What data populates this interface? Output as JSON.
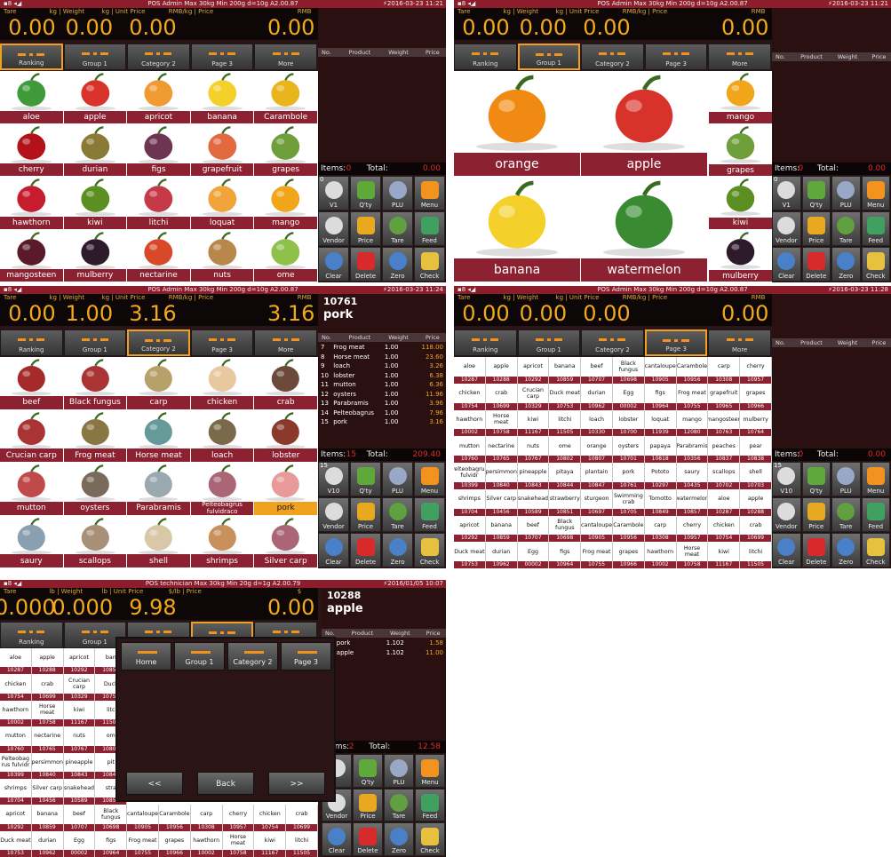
{
  "colors": {
    "accent": "#f2a91a",
    "bar": "#8c2231",
    "dark": "#2a1416",
    "total": "#e32b2b"
  },
  "screens": [
    {
      "status_center": "POS  Admin  Max 30kg Min 200g d=10g  A2.00.87",
      "status_time": "2016-03-23 11:21",
      "hdr": {
        "labels": [
          "Tare",
          "kg | Weight",
          "kg | Unit Price",
          "RMB/kg | Price",
          "RMB"
        ],
        "values": [
          "0.00",
          "0.00",
          "0.00",
          "0.00"
        ]
      },
      "tabs": [
        "Ranking",
        "Group 1",
        "Category 2",
        "Page 3",
        "More"
      ],
      "sel_tab": 0,
      "items": [
        "aloe",
        "apple",
        "apricot",
        "banana",
        "Carambole",
        "cherry",
        "durian",
        "figs",
        "grapefruit",
        "grapes",
        "hawthorn",
        "kiwi",
        "litchi",
        "loquat",
        "mango",
        "mangosteen",
        "mulberry",
        "nectarine",
        "nuts",
        "ome"
      ],
      "cols": [
        "No.",
        "Product",
        "Weight",
        "Price"
      ],
      "rows": [],
      "items_label": "Items:",
      "items_count": "0",
      "total_label": "Total:",
      "total": "0.00",
      "btns": [
        "V1",
        "Q'ty",
        "PLU",
        "Menu",
        "Vendor",
        "Price",
        "Tare",
        "Feed",
        "Clear",
        "Delete",
        "Zero",
        "Check"
      ],
      "v_badge": "0"
    },
    {
      "status_center": "POS  Admin  Max 30kg Min 200g d=10g  A2.00.87",
      "status_time": "2016-03-23 11:21",
      "hdr": {
        "labels": [
          "Tare",
          "kg | Weight",
          "kg | Unit Price",
          "RMB/kg | Price",
          "RMB"
        ],
        "values": [
          "0.00",
          "0.00",
          "0.00",
          "0.00"
        ]
      },
      "tabs": [
        "Ranking",
        "Group 1",
        "Category 2",
        "Page 3",
        "More"
      ],
      "sel_tab": 1,
      "big_items": [
        "orange",
        "apple",
        "banana",
        "watermelon"
      ],
      "side_items": [
        "mango",
        "grapes",
        "kiwi",
        "mulberry"
      ],
      "cols": [
        "No.",
        "Product",
        "Weight",
        "Price"
      ],
      "items_label": "Items:",
      "items_count": "0",
      "total_label": "Total:",
      "total": "0.00",
      "btns": [
        "V1",
        "Q'ty",
        "PLU",
        "Menu",
        "Vendor",
        "Price",
        "Tare",
        "Feed",
        "Clear",
        "Delete",
        "Zero",
        "Check"
      ],
      "v_badge": "0"
    },
    {
      "status_center": "POS  Admin  Max 30kg Min 200g d=10g  A2.00.87",
      "status_time": "2016-03-23 11:24",
      "hdr": {
        "labels": [
          "Tare",
          "kg | Weight",
          "kg | Unit Price",
          "RMB/kg | Price",
          "RMB"
        ],
        "values": [
          "0.00",
          "1.00",
          "3.16",
          "3.16"
        ]
      },
      "plu": "10761",
      "product": "pork",
      "tabs": [
        "Ranking",
        "Group 1",
        "Category 2",
        "Page 3",
        "More"
      ],
      "sel_tab": 2,
      "items": [
        "beef",
        "Black fungus",
        "carp",
        "chicken",
        "crab",
        "Crucian carp",
        "Frog meat",
        "Horse meat",
        "loach",
        "lobster",
        "mutton",
        "oysters",
        "Parabramis",
        "Pelteobagrus fulvidraco",
        "pork",
        "saury",
        "scallops",
        "shell",
        "shrimps",
        "Silver carp"
      ],
      "hi_item": 14,
      "cols": [
        "No.",
        "Product",
        "Weight",
        "Price"
      ],
      "rows": [
        [
          "7",
          "Frog meat",
          "1.00",
          "118.00"
        ],
        [
          "8",
          "Horse meat",
          "1.00",
          "23.60"
        ],
        [
          "9",
          "loach",
          "1.00",
          "3.26"
        ],
        [
          "10",
          "lobster",
          "1.00",
          "6.38"
        ],
        [
          "11",
          "mutton",
          "1.00",
          "6.36"
        ],
        [
          "12",
          "oysters",
          "1.00",
          "11.96"
        ],
        [
          "13",
          "Parabramis",
          "1.00",
          "3.96"
        ],
        [
          "14",
          "Pelteobagrus",
          "1.00",
          "7.96"
        ],
        [
          "15",
          "pork",
          "1.00",
          "3.16"
        ]
      ],
      "items_label": "Items:",
      "items_count": "15",
      "total_label": "Total:",
      "total": "209.40",
      "btns": [
        "V10",
        "Q'ty",
        "PLU",
        "Menu",
        "Vendor",
        "Price",
        "Tare",
        "Feed",
        "Clear",
        "Delete",
        "Zero",
        "Check"
      ],
      "v_badge": "15"
    },
    {
      "status_center": "POS  Admin  Max 30kg Min 200g d=10g  A2.00.87",
      "status_time": "2016-03-23 11:28",
      "hdr": {
        "labels": [
          "Tare",
          "kg | Weight",
          "kg | Unit Price",
          "RMB/kg | Price",
          "RMB"
        ],
        "values": [
          "0.00",
          "0.00",
          "0.00",
          "0.00"
        ]
      },
      "tabs": [
        "Ranking",
        "Group 1",
        "Category 2",
        "Page 3",
        "More"
      ],
      "sel_tab": 3,
      "tcells": [
        [
          "aloe",
          "10287"
        ],
        [
          "apple",
          "10288"
        ],
        [
          "apricot",
          "10292"
        ],
        [
          "banana",
          "10859"
        ],
        [
          "beef",
          "10707"
        ],
        [
          "Black fungus",
          "10698"
        ],
        [
          "cantaloupe",
          "10905"
        ],
        [
          "Carambole",
          "10956"
        ],
        [
          "carp",
          "10308"
        ],
        [
          "cherry",
          "10957"
        ],
        [
          "chicken",
          "10754"
        ],
        [
          "crab",
          "10699"
        ],
        [
          "Crucian carp",
          "10329"
        ],
        [
          "Duck meat",
          "10753"
        ],
        [
          "durian",
          "10962"
        ],
        [
          "Egg",
          "00002"
        ],
        [
          "figs",
          "10964"
        ],
        [
          "Frog meat",
          "10755"
        ],
        [
          "grapefruit",
          "10965"
        ],
        [
          "grapes",
          "10966"
        ],
        [
          "hawthorn",
          "10002"
        ],
        [
          "Horse meat",
          "10758"
        ],
        [
          "kiwi",
          "11167"
        ],
        [
          "litchi",
          "11505"
        ],
        [
          "loach",
          "10330"
        ],
        [
          "lobster",
          "10700"
        ],
        [
          "loquat",
          "11939"
        ],
        [
          "mango",
          "12080"
        ],
        [
          "mangosteen",
          "10763"
        ],
        [
          "mulberry",
          "10764"
        ],
        [
          "mutton",
          "10760"
        ],
        [
          "nectarine",
          "10765"
        ],
        [
          "nuts",
          "10767"
        ],
        [
          "ome",
          "10802"
        ],
        [
          "orange",
          "10807"
        ],
        [
          "oysters",
          "10701"
        ],
        [
          "papaya",
          "10818"
        ],
        [
          "Parabramis",
          "10356"
        ],
        [
          "peaches",
          "10837"
        ],
        [
          "pear",
          "10838"
        ],
        [
          "Pelteobagrus fulvidr",
          "10399"
        ],
        [
          "persimmon",
          "10840"
        ],
        [
          "pineapple",
          "10843"
        ],
        [
          "pitaya",
          "10844"
        ],
        [
          "plantain",
          "10847"
        ],
        [
          "pork",
          "10761"
        ],
        [
          "Pototo",
          "10297"
        ],
        [
          "saury",
          "10435"
        ],
        [
          "scallops",
          "10702"
        ],
        [
          "shell",
          "10703"
        ],
        [
          "shrimps",
          "10704"
        ],
        [
          "Silver carp",
          "10456"
        ],
        [
          "snakehead",
          "10589"
        ],
        [
          "strawberry",
          "10851"
        ],
        [
          "sturgeon",
          "10697"
        ],
        [
          "Swimming crab",
          "10705"
        ],
        [
          "Tomotto",
          "10849"
        ],
        [
          "watermelon",
          "10857"
        ],
        [
          "aloe",
          "10287"
        ],
        [
          "apple",
          "10288"
        ],
        [
          "apricot",
          "10292"
        ],
        [
          "banana",
          "10859"
        ],
        [
          "beef",
          "10707"
        ],
        [
          "Black fungus",
          "10698"
        ],
        [
          "cantaloupe",
          "10905"
        ],
        [
          "Carambole",
          "10956"
        ],
        [
          "carp",
          "10308"
        ],
        [
          "cherry",
          "10957"
        ],
        [
          "chicken",
          "10754"
        ],
        [
          "crab",
          "10699"
        ],
        [
          "Duck meat",
          "10753"
        ],
        [
          "durian",
          "10962"
        ],
        [
          "Egg",
          "00002"
        ],
        [
          "figs",
          "10964"
        ],
        [
          "Frog meat",
          "10755"
        ],
        [
          "grapes",
          "10966"
        ],
        [
          "hawthorn",
          "10002"
        ],
        [
          "Horse meat",
          "10758"
        ],
        [
          "kiwi",
          "11167"
        ],
        [
          "litchi",
          "11505"
        ]
      ],
      "cols": [
        "No.",
        "Product",
        "Weight",
        "Price"
      ],
      "items_label": "Items:",
      "items_count": "0",
      "total_label": "Total:",
      "total": "0.00",
      "btns": [
        "V10",
        "Q'ty",
        "PLU",
        "Menu",
        "Vendor",
        "Price",
        "Tare",
        "Feed",
        "Clear",
        "Delete",
        "Zero",
        "Check"
      ],
      "v_badge": "15"
    },
    {
      "status_center": "POS  technician  Max 30kg Min 20g d=1g  A2.00.79",
      "status_time": "2016/01/05 10:07",
      "hdr": {
        "labels": [
          "Tare",
          "lb | Weight",
          "lb | Unit Price",
          "$/lb | Price",
          "$"
        ],
        "values": [
          "0.000",
          "0.000",
          "9.98",
          "0.00"
        ]
      },
      "plu": "10288",
      "product": "apple",
      "tabs": [
        "Ranking",
        "Group 1",
        "",
        "",
        ""
      ],
      "sel_tab": 3,
      "tcells": [
        [
          "aloe",
          "10287"
        ],
        [
          "apple",
          "10288"
        ],
        [
          "apricot",
          "10292"
        ],
        [
          "ban",
          "10859"
        ],
        [
          "chicken",
          "10754"
        ],
        [
          "crab",
          "10699"
        ],
        [
          "Crucian carp",
          "10329"
        ],
        [
          "Duck",
          "10753"
        ],
        [
          "hawthorn",
          "10002"
        ],
        [
          "Horse meat",
          "10758"
        ],
        [
          "kiwi",
          "11167"
        ],
        [
          "litc",
          "11505"
        ],
        [
          "mutton",
          "10760"
        ],
        [
          "nectarine",
          "10765"
        ],
        [
          "nuts",
          "10767"
        ],
        [
          "om",
          "10802"
        ],
        [
          "Pelteobag rus fulvidr",
          "10399"
        ],
        [
          "persimmon",
          "10840"
        ],
        [
          "pineapple",
          "10843"
        ],
        [
          "pit",
          "10844"
        ],
        [
          "shrimps",
          "10704"
        ],
        [
          "Silver carp",
          "10456"
        ],
        [
          "snakehead",
          "10589"
        ],
        [
          "stra",
          "10851"
        ],
        [
          "apricot",
          "10292"
        ],
        [
          "banana",
          "10859"
        ],
        [
          "beef",
          "10707"
        ],
        [
          "Black fungus",
          "10698"
        ],
        [
          "cantaloupe",
          "10905"
        ],
        [
          "Carambole",
          "10956"
        ],
        [
          "carp",
          "10308"
        ],
        [
          "cherry",
          "10957"
        ],
        [
          "chicken",
          "10754"
        ],
        [
          "crab",
          "10699"
        ],
        [
          "Duck meat",
          "10753"
        ],
        [
          "durian",
          "10962"
        ],
        [
          "Egg",
          "00002"
        ],
        [
          "figs",
          "10964"
        ],
        [
          "Frog meat",
          "10755"
        ],
        [
          "grapes",
          "10966"
        ],
        [
          "hawthorn",
          "10002"
        ],
        [
          "Horse meat",
          "10758"
        ],
        [
          "kiwi",
          "11167"
        ],
        [
          "litchi",
          "11505"
        ]
      ],
      "cols": [
        "No.",
        "Product",
        "Weight",
        "Price"
      ],
      "rows": [
        [
          "1",
          "pork",
          "1.102",
          "1.58"
        ],
        [
          "2",
          "apple",
          "1.102",
          "11.00"
        ]
      ],
      "items_label": "Items:",
      "items_count": "2",
      "total_label": "Total:",
      "total": "12.58",
      "btns": [
        "",
        "Q'ty",
        "PLU",
        "Menu",
        "Vendor",
        "Price",
        "Tare",
        "Feed",
        "Clear",
        "Delete",
        "Zero",
        "Check"
      ],
      "popup": {
        "tabs": [
          "Home",
          "Group 1",
          "Category 2",
          "Page 3"
        ],
        "prev": "<<",
        "back": "Back",
        "next": ">>"
      }
    }
  ]
}
